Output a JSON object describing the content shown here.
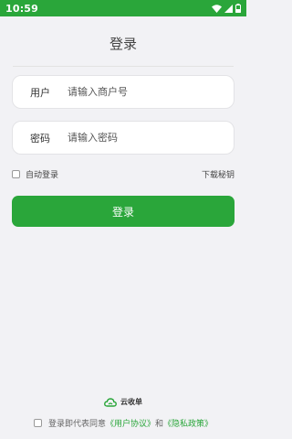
{
  "status_bar": {
    "time": "10:59",
    "icons": [
      "wifi-icon",
      "signal-icon",
      "battery-icon"
    ],
    "color": "#2aa63a"
  },
  "page": {
    "title": "登录"
  },
  "form": {
    "username_label": "用户",
    "username_placeholder": "请输入商户号",
    "password_label": "密码",
    "password_placeholder": "请输入密码",
    "auto_login_label": "自动登录",
    "auto_login_checked": false,
    "download_key_label": "下载秘钥",
    "submit_label": "登录"
  },
  "footer": {
    "brand_name": "云收单",
    "brand_icon": "cloud-logo-icon",
    "agree_prefix": "登录即代表同意",
    "user_agreement": "《用户协议》",
    "conjunction": "和",
    "privacy_policy": "《隐私政策》",
    "agree_checked": false
  },
  "colors": {
    "accent": "#2aa63a",
    "background": "#f2f2f5"
  }
}
